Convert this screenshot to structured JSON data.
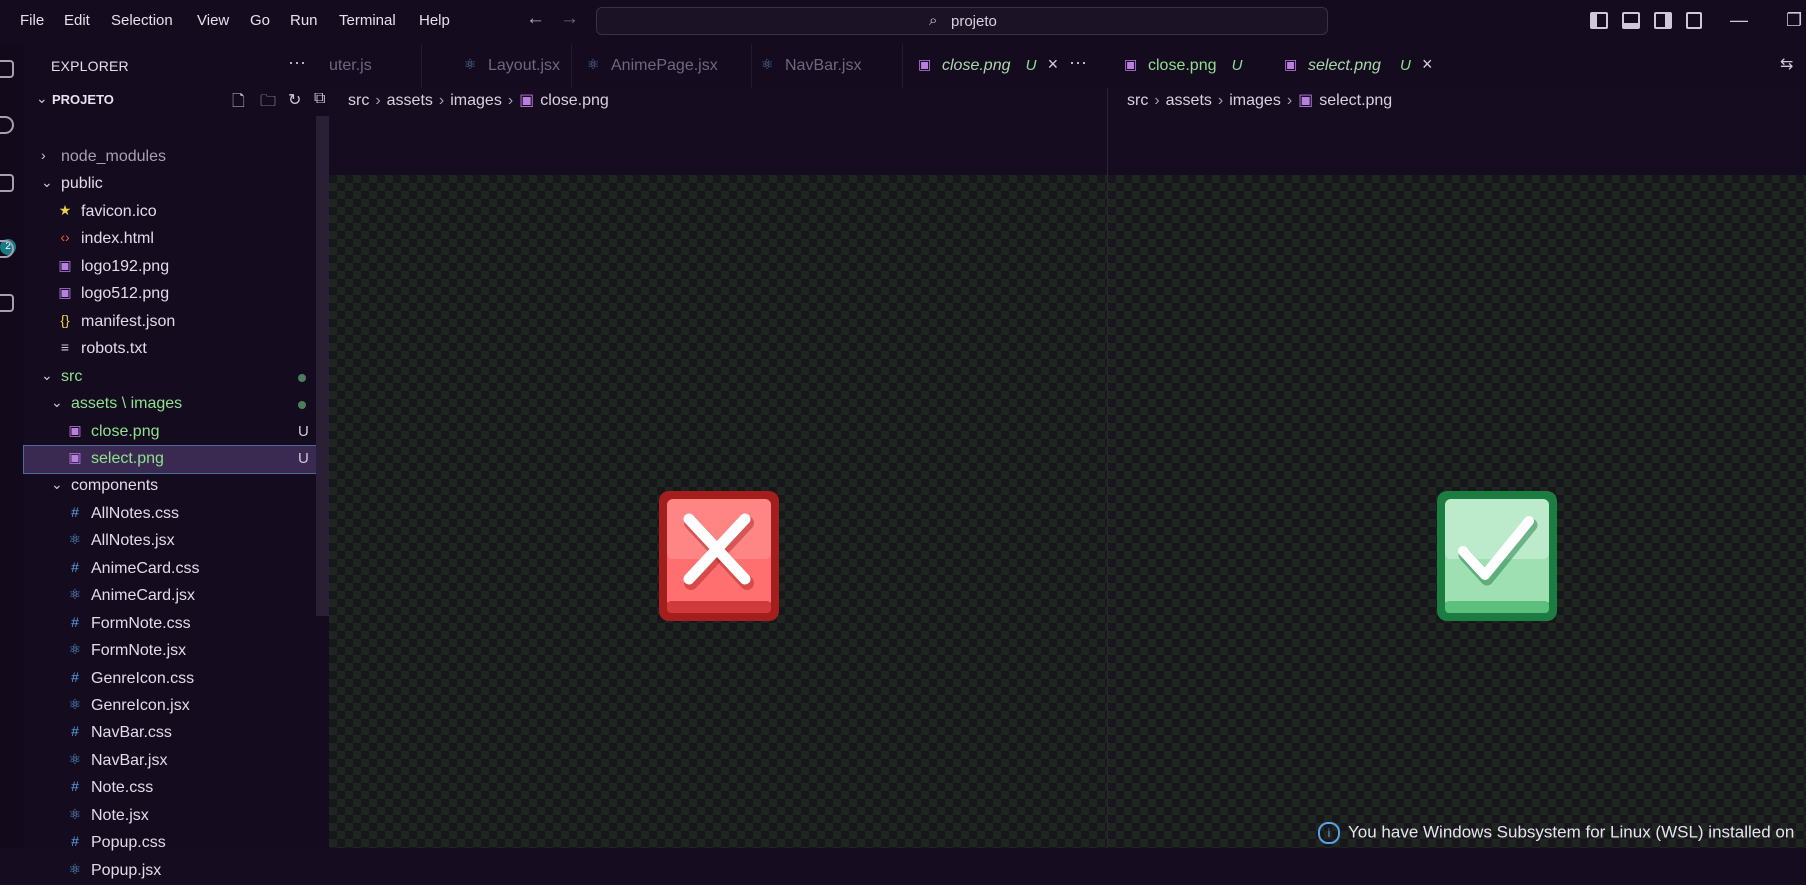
{
  "menu": [
    "File",
    "Edit",
    "Selection",
    "View",
    "Go",
    "Run",
    "Terminal",
    "Help"
  ],
  "command_center": {
    "text": "projeto"
  },
  "activity": {
    "scm_badge": "2"
  },
  "sidebar": {
    "title": "EXPLORER",
    "more": "···",
    "project": "PROJETO",
    "tree": [
      {
        "label": "node_modules",
        "kind": "folder-closed",
        "depth": 0
      },
      {
        "label": "public",
        "kind": "folder-open",
        "depth": 0
      },
      {
        "label": "favicon.ico",
        "kind": "star",
        "depth": 1
      },
      {
        "label": "index.html",
        "kind": "html",
        "depth": 1
      },
      {
        "label": "logo192.png",
        "kind": "image",
        "depth": 1
      },
      {
        "label": "logo512.png",
        "kind": "image",
        "depth": 1
      },
      {
        "label": "manifest.json",
        "kind": "json",
        "depth": 1
      },
      {
        "label": "robots.txt",
        "kind": "text",
        "depth": 1
      },
      {
        "label": "src",
        "kind": "folder-open",
        "depth": 0,
        "dot": true,
        "color": "green"
      },
      {
        "label": "assets \\ images",
        "kind": "folder-open",
        "depth": 1,
        "dot": true,
        "color": "green"
      },
      {
        "label": "close.png",
        "kind": "image",
        "depth": 2,
        "status": "U",
        "color": "green"
      },
      {
        "label": "select.png",
        "kind": "image",
        "depth": 2,
        "status": "U",
        "color": "green",
        "selected": true
      },
      {
        "label": "components",
        "kind": "folder-open",
        "depth": 1
      },
      {
        "label": "AllNotes.css",
        "kind": "css",
        "depth": 2
      },
      {
        "label": "AllNotes.jsx",
        "kind": "react",
        "depth": 2
      },
      {
        "label": "AnimeCard.css",
        "kind": "css",
        "depth": 2
      },
      {
        "label": "AnimeCard.jsx",
        "kind": "react",
        "depth": 2
      },
      {
        "label": "FormNote.css",
        "kind": "css",
        "depth": 2
      },
      {
        "label": "FormNote.jsx",
        "kind": "react",
        "depth": 2
      },
      {
        "label": "GenreIcon.css",
        "kind": "css",
        "depth": 2
      },
      {
        "label": "GenreIcon.jsx",
        "kind": "react",
        "depth": 2
      },
      {
        "label": "NavBar.css",
        "kind": "css",
        "depth": 2
      },
      {
        "label": "NavBar.jsx",
        "kind": "react",
        "depth": 2
      },
      {
        "label": "Note.css",
        "kind": "css",
        "depth": 2
      },
      {
        "label": "Note.jsx",
        "kind": "react",
        "depth": 2
      },
      {
        "label": "Popup.css",
        "kind": "css",
        "depth": 2
      },
      {
        "label": "Popup.jsx",
        "kind": "react",
        "depth": 2
      }
    ]
  },
  "left_group": {
    "tabs": [
      {
        "label": "uter.js",
        "kind": "none",
        "dim": true
      },
      {
        "label": "Layout.jsx",
        "kind": "react",
        "dim": true
      },
      {
        "label": "AnimePage.jsx",
        "kind": "react",
        "dim": true
      },
      {
        "label": "NavBar.jsx",
        "kind": "react",
        "dim": true
      },
      {
        "label": "close.png",
        "kind": "image",
        "active": true,
        "status": "U",
        "close": "×"
      }
    ],
    "overflow": "···",
    "breadcrumb": [
      "src",
      "assets",
      "images",
      "close.png"
    ]
  },
  "right_group": {
    "tabs": [
      {
        "label": "close.png",
        "kind": "image",
        "status": "U"
      },
      {
        "label": "select.png",
        "kind": "image",
        "active": true,
        "status": "U",
        "close": "×"
      }
    ],
    "breadcrumb": [
      "src",
      "assets",
      "images",
      "select.png"
    ]
  },
  "notification": {
    "text": "You have Windows Subsystem for Linux (WSL) installed on"
  },
  "colors": {
    "close_red": "#e8453c",
    "select_green": "#2e9e55",
    "accent_green": "#8fe08f"
  }
}
